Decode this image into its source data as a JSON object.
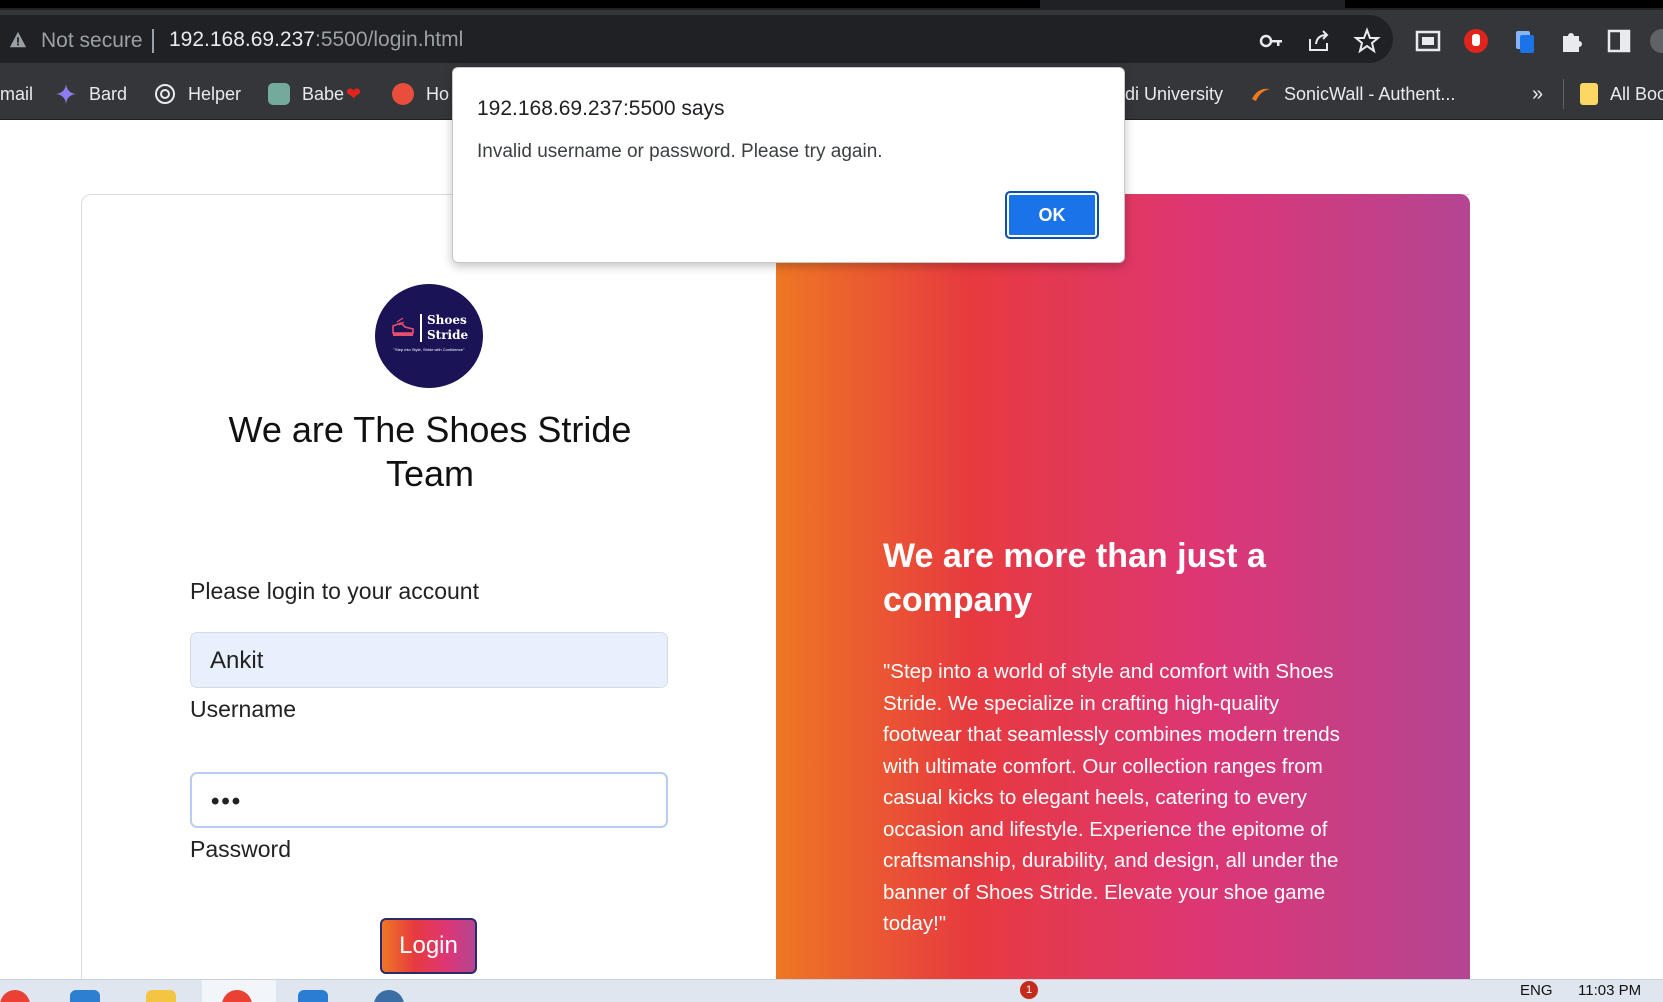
{
  "browser": {
    "security_label": "Not secure",
    "url_host": "192.168.69.237",
    "url_rest": ":5500/login.html",
    "toolbar_icons": [
      "key-icon",
      "share-icon",
      "star-icon",
      "media-icon",
      "adblock-icon",
      "copy-icon",
      "extensions-icon",
      "sidepanel-icon",
      "profile-icon"
    ],
    "more_bookmarks": "»",
    "bookmarks": [
      {
        "label": "mail",
        "icon": "gmail-icon"
      },
      {
        "label": "Bard",
        "icon": "bard-icon"
      },
      {
        "label": "Helper",
        "icon": "openai-icon"
      },
      {
        "label": "Babe",
        "icon": "chatgpt-icon"
      },
      {
        "label": "Ho",
        "icon": "s-icon"
      },
      {
        "label": "di University",
        "icon": "university-icon"
      },
      {
        "label": "SonicWall - Authent...",
        "icon": "sonicwall-icon"
      },
      {
        "label": "All Boo",
        "icon": "folder-icon"
      }
    ]
  },
  "dialog": {
    "title": "192.168.69.237:5500 says",
    "message": "Invalid username or password. Please try again.",
    "ok_label": "OK"
  },
  "page": {
    "logo": {
      "line1": "Shoes",
      "line2": "Stride",
      "tagline": "\"Step into Style, Stride with Confidence\""
    },
    "heading": "We are The Shoes Stride Team",
    "prompt": "Please login to your account",
    "username_value": "Ankit",
    "username_label": "Username",
    "password_mask": "•••",
    "password_label": "Password",
    "login_label": "Login",
    "right_title": "We are more than just a company",
    "right_text": "\"Step into a world of style and comfort with Shoes Stride. We specialize in crafting high-quality footwear that seamlessly combines modern trends with ultimate comfort. Our collection ranges from casual kicks to elegant heels, catering to every occasion and lifestyle. Experience the epitome of craftsmanship, durability, and design, all under the banner of Shoes Stride. Elevate your shoe game today!\""
  },
  "taskbar": {
    "language": "ENG",
    "time": "11:03 PM",
    "notification_count": "1"
  },
  "colors": {
    "gradient": [
      "#ee7724",
      "#d8363a",
      "#dd3675",
      "#b44593"
    ],
    "dialog_button": "#1a73e8",
    "logo_bg": "#1a1457"
  }
}
